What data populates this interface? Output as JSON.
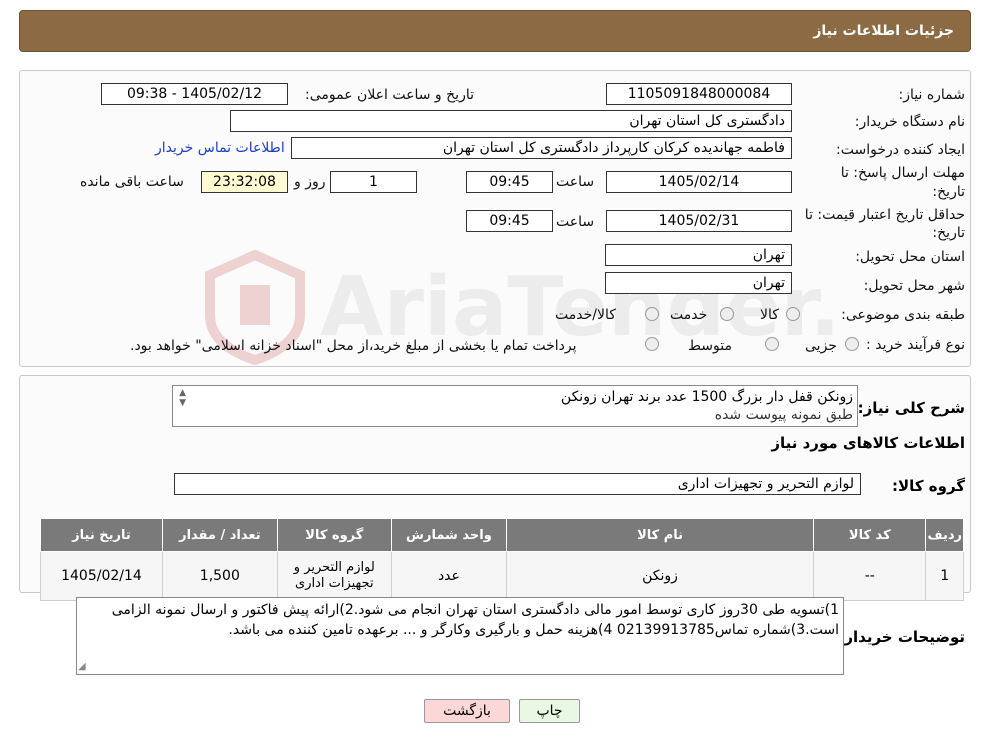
{
  "header": {
    "title": "جزئیات اطلاعات نیاز"
  },
  "form": {
    "need_number_label": "شماره نیاز:",
    "need_number": "1105091848000084",
    "announce_label": "تاریخ و ساعت اعلان عمومی:",
    "announce_value": "1405/02/12 - 09:38",
    "buyer_org_label": "نام دستگاه خریدار:",
    "buyer_org": "دادگستری کل استان تهران",
    "creator_label": "ایجاد کننده درخواست:",
    "creator": "فاطمه جهاندیده کرکان کارپرداز دادگستری کل استان تهران",
    "contact_link": "اطلاعات تماس خریدار",
    "deadline_label_1": "مهلت ارسال پاسخ: تا",
    "deadline_label_2": "تاریخ:",
    "deadline_date": "1405/02/14",
    "time_label": "ساعت",
    "deadline_time": "09:45",
    "days_value": "1",
    "days_label": "روز و",
    "remaining_time": "23:32:08",
    "remaining_label": "ساعت باقی مانده",
    "validity_label_1": "حداقل تاریخ اعتبار قیمت: تا",
    "validity_label_2": "تاریخ:",
    "validity_date": "1405/02/31",
    "validity_time": "09:45",
    "province_label": "استان محل تحویل:",
    "province": "تهران",
    "city_label": "شهر محل تحویل:",
    "city": "تهران",
    "category_label": "طبقه بندی موضوعی:",
    "category_options": [
      "کالا",
      "خدمت",
      "کالا/خدمت"
    ],
    "process_label": "نوع فرآیند خرید :",
    "process_options": [
      "جزیی",
      "متوسط"
    ],
    "process_note": "پرداخت تمام یا بخشی از مبلغ خرید،از محل \"اسناد خزانه اسلامی\" خواهد بود."
  },
  "details": {
    "summary_label": "شرح کلی نیاز:",
    "summary_line1": "زونکن قفل دار بزرگ 1500 عدد برند تهران زونکن",
    "summary_line2": "طبق نمونه پیوست شده",
    "goods_info_title": "اطلاعات کالاهای مورد نیاز",
    "goods_group_label": "گروه کالا:",
    "goods_group": "لوازم التحریر و تجهیزات اداری"
  },
  "table": {
    "headers": [
      "ردیف",
      "کد کالا",
      "نام کالا",
      "واحد شمارش",
      "گروه کالا",
      "تعداد / مقدار",
      "تاریخ نیاز"
    ],
    "rows": [
      [
        "1",
        "--",
        "زونکن",
        "عدد",
        "لوازم التحریر و تجهیزات اداری",
        "1,500",
        "1405/02/14"
      ]
    ]
  },
  "buyer_notes": {
    "label": "توضیحات خریدار:",
    "text": "1)تسویه طی 30روز کاری توسط امور مالی دادگستری استان تهران انجام می شود.2)ارائه پیش فاکتور و ارسال نمونه الزامی است.3)شماره تماس02139913785 4)هزینه حمل و بارگیری وکارگر و ... برعهده تامین کننده می باشد."
  },
  "buttons": {
    "print": "چاپ",
    "back": "بازگشت"
  },
  "watermark": {
    "text": "AriaTender.neT"
  },
  "colors": {
    "header": "#8b6a44",
    "link": "#1a3ec6",
    "back_button": "#fbd7d7",
    "print_button": "#e9f8e2",
    "table_header": "#7a7a7a"
  }
}
